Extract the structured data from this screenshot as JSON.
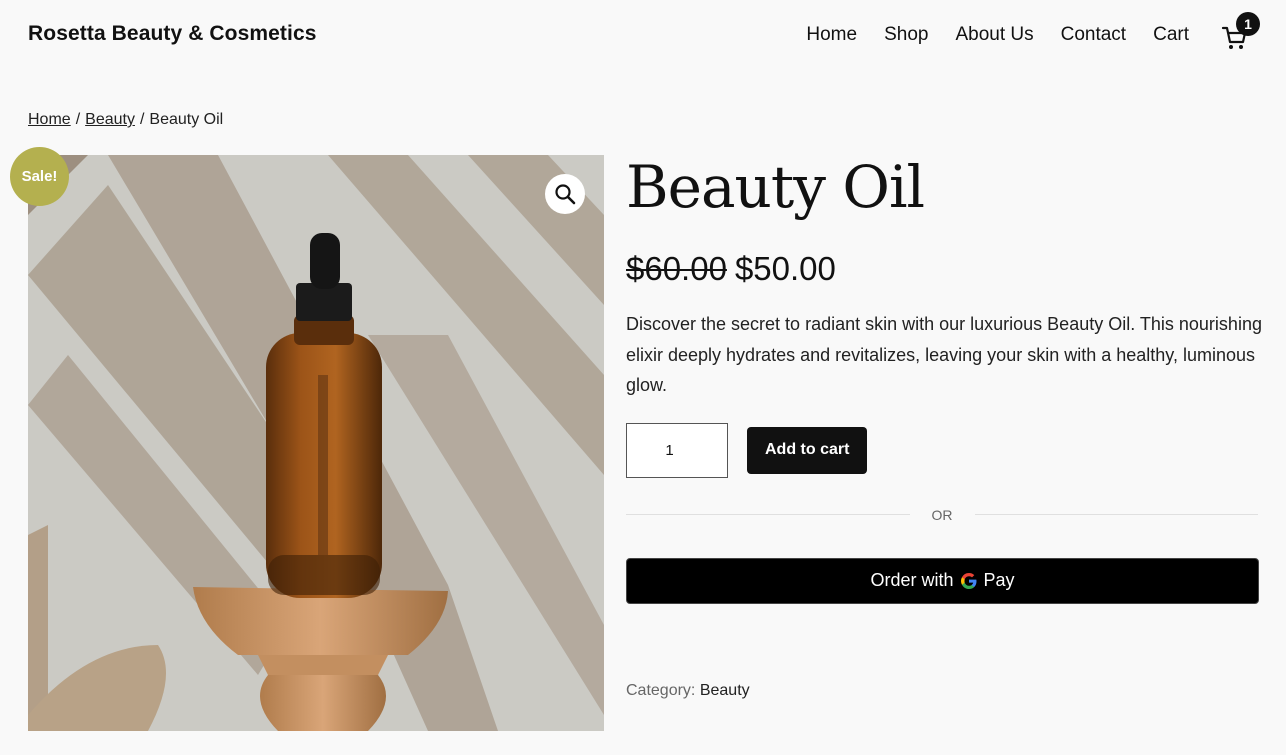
{
  "header": {
    "site_title": "Rosetta Beauty & Cosmetics",
    "nav": [
      {
        "label": "Home"
      },
      {
        "label": "Shop"
      },
      {
        "label": "About Us"
      },
      {
        "label": "Contact"
      },
      {
        "label": "Cart"
      }
    ],
    "cart_icon": "cart-icon",
    "cart_count": "1"
  },
  "breadcrumb": {
    "items": [
      {
        "label": "Home",
        "link": true
      },
      {
        "label": "Beauty",
        "link": true
      },
      {
        "label": "Beauty Oil",
        "link": false
      }
    ],
    "separator": "/"
  },
  "product": {
    "sale_badge": "Sale!",
    "zoom_icon": "magnifier-icon",
    "image_alt": "Amber dropper bottle on wooden pedestal",
    "title": "Beauty Oil",
    "regular_price": "$60.00",
    "sale_price": "$50.00",
    "description": "Discover the secret to radiant skin with our luxurious Beauty Oil. This nourishing elixir deeply hydrates and revitalizes, leaving your skin with a healthy, luminous glow.",
    "quantity": "1",
    "add_to_cart_label": "Add to cart",
    "or_label": "OR",
    "gpay_label": "Order with",
    "gpay_brand": "Pay",
    "category_label": "Category:",
    "category_value": "Beauty"
  },
  "colors": {
    "sale_badge": "#b4b04f",
    "button": "#111111",
    "gpay_button": "#000000",
    "background": "#f9f9f9"
  }
}
